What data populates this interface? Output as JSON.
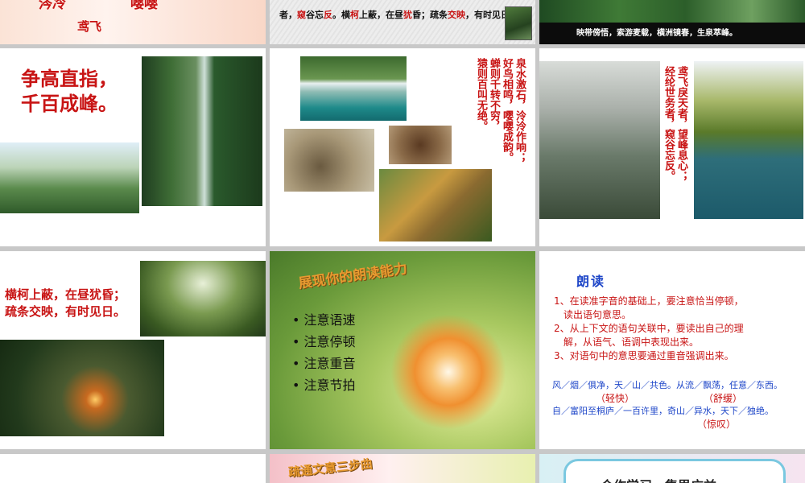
{
  "colors": {
    "red": "#c81414",
    "blue": "#1e46c8",
    "grid_bg": "#c8c8c8"
  },
  "slides": [
    {
      "id": 1,
      "line1_a": "涔冷",
      "line1_b": "嘤嘤",
      "line2": "鸢飞"
    },
    {
      "id": 2,
      "t1": "者，",
      "t2": "窥",
      "t3": "谷忘",
      "t4": "反",
      "t5": "。横",
      "t6": "柯",
      "t7": "上蔽，在昼",
      "t8": "犹",
      "t9": "昏；疏条",
      "t10": "交映",
      "t11": "，有时见日"
    },
    {
      "id": 3,
      "caption": "映带傍悟，索游麦载，横洲镜春，生泉萃峰。"
    },
    {
      "id": 4,
      "line1": "争高直指，",
      "line2": "千百成峰。"
    },
    {
      "id": 5,
      "col1": "泉水激石，泠泠作响；",
      "col2": "好鸟相鸣，嘤嘤成韵。",
      "col3": "蝉则千转不穷，",
      "col4": "猿则百叫无绝。"
    },
    {
      "id": 6,
      "col1": "鸢飞戾天者，望峰息心；",
      "col2": "经纶世务者，窥谷忘反。"
    },
    {
      "id": 7,
      "line1": "横柯上蔽，在昼犹昏；",
      "line2": "疏条交映，有时见日。"
    },
    {
      "id": 8,
      "title": "展现你的朗读能力",
      "items": [
        "注意语速",
        "注意停顿",
        "注意重音",
        "注意节拍"
      ]
    },
    {
      "id": 9,
      "title": "朗读",
      "rules": [
        "1、在读准字音的基础上，要注意恰当停顿，",
        "读出语句意思。",
        "2、从上下文的语句关联中，要读出自己的理",
        "解，从语气、语调中表现出来。",
        "3、对语句中的意思要通过重音强调出来。"
      ],
      "ex1": "风／烟／俱净，天／山／共色。从流／飘荡，任意／东西。",
      "ex1_note_a": "（轻快）",
      "ex1_note_b": "（舒缓）",
      "ex2": "自／富阳至桐庐／一百许里，奇山／异水，天下／独绝。",
      "ex2_note": "（惊叹）"
    },
    {
      "id": 10
    },
    {
      "id": 11,
      "title": "疏通文意三步曲"
    },
    {
      "id": 12,
      "title": "合作学习，集思广益"
    }
  ]
}
